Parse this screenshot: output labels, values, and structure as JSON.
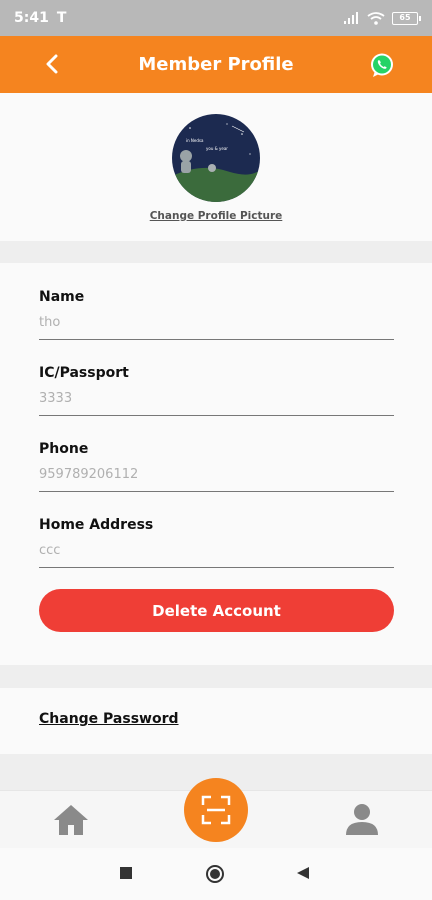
{
  "status_bar": {
    "time": "5:41",
    "carrier_icon": "T",
    "battery": "65"
  },
  "header": {
    "title": "Member Profile",
    "back_icon": "chevron-left-icon",
    "action_icon": "whatsapp-icon"
  },
  "profile": {
    "change_picture_label": "Change Profile Picture",
    "avatar_text_1": "in Nedsa",
    "avatar_text_2": "you & year"
  },
  "form": {
    "name": {
      "label": "Name",
      "value": "tho"
    },
    "ic": {
      "label": "IC/Passport",
      "value": "3333"
    },
    "phone": {
      "label": "Phone",
      "value": "959789206112"
    },
    "address": {
      "label": "Home Address",
      "value": "ccc"
    }
  },
  "delete_button": "Delete Account",
  "change_password": "Change Password",
  "bottom_nav": {
    "home_icon": "home-icon",
    "scan_icon": "scan-icon",
    "profile_icon": "person-icon"
  },
  "colors": {
    "primary": "#f5841f",
    "danger": "#ef3e36",
    "whatsapp": "#25d366"
  }
}
